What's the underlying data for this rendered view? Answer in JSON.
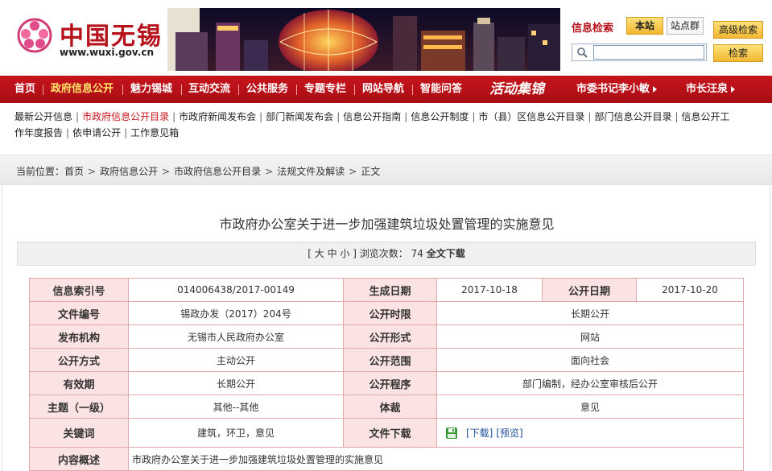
{
  "site": {
    "logo_cn": "中国无锡",
    "logo_url": "www.wuxi.gov.cn"
  },
  "search": {
    "title": "信息检索",
    "site_label": "本站",
    "group_label": "站点群",
    "advanced_label": "高级检索",
    "search_label": "检索",
    "placeholder": ""
  },
  "nav": {
    "items": [
      {
        "label": "首页"
      },
      {
        "label": "政府信息公开"
      },
      {
        "label": "魅力锡城"
      },
      {
        "label": "互动交流"
      },
      {
        "label": "公共服务"
      },
      {
        "label": "专题专栏"
      },
      {
        "label": "网站导航"
      },
      {
        "label": "智能问答"
      }
    ],
    "script_label": "活动集锦",
    "secretary_label": "市委书记李小敏",
    "mayor_label": "市长汪泉"
  },
  "subnav": {
    "line1": [
      "最新公开信息",
      "市政府信息公开目录",
      "市政府新闻发布会",
      "部门新闻发布会",
      "信息公开指南",
      "信息公开制度",
      "市（县）区信息公开目录",
      "部门信息公开目录",
      "信息公开工"
    ],
    "line2": [
      "作年度报告",
      "依申请公开",
      "工作意见箱"
    ]
  },
  "breadcrumb": {
    "prefix": "当前位置：",
    "items": [
      "首页",
      "政府信息公开",
      "市政府信息公开目录",
      "法规文件及解读",
      "正文"
    ]
  },
  "document": {
    "title": "市政府办公室关于进一步加强建筑垃圾处置管理的实施意见",
    "font_size_label": "[ 大 中 小 ]",
    "views_label": "浏览次数：",
    "views_count": "74",
    "download_all_label": "全文下载"
  },
  "info": {
    "rows": [
      {
        "l1": "信息索引号",
        "v1": "014006438/2017-00149",
        "l2": "生成日期",
        "v2": "2017-10-18",
        "l3": "公开日期",
        "v3": "2017-10-20"
      },
      {
        "l1": "文件编号",
        "v1": "锡政办发（2017）204号",
        "l2": "公开时限",
        "v2": "长期公开"
      },
      {
        "l1": "发布机构",
        "v1": "无锡市人民政府办公室",
        "l2": "公开形式",
        "v2": "网站"
      },
      {
        "l1": "公开方式",
        "v1": "主动公开",
        "l2": "公开范围",
        "v2": "面向社会"
      },
      {
        "l1": "有效期",
        "v1": "长期公开",
        "l2": "公开程序",
        "v2": "部门编制，经办公室审核后公开"
      },
      {
        "l1": "主题（一级）",
        "v1": "其他--其他",
        "l2": "体裁",
        "v2": "意见"
      },
      {
        "l1": "关键词",
        "v1": "建筑，环卫，意见",
        "l2": "文件下载",
        "v2_download": "[下载]",
        "v2_preview": "[预览]"
      },
      {
        "l1": "内容概述",
        "v1": "市政府办公室关于进一步加强建筑垃圾处置管理的实施意见"
      }
    ]
  },
  "colors": {
    "brand_red": "#c8141c",
    "label_bg": "#fbe3e3",
    "border": "#e2a9a9"
  }
}
